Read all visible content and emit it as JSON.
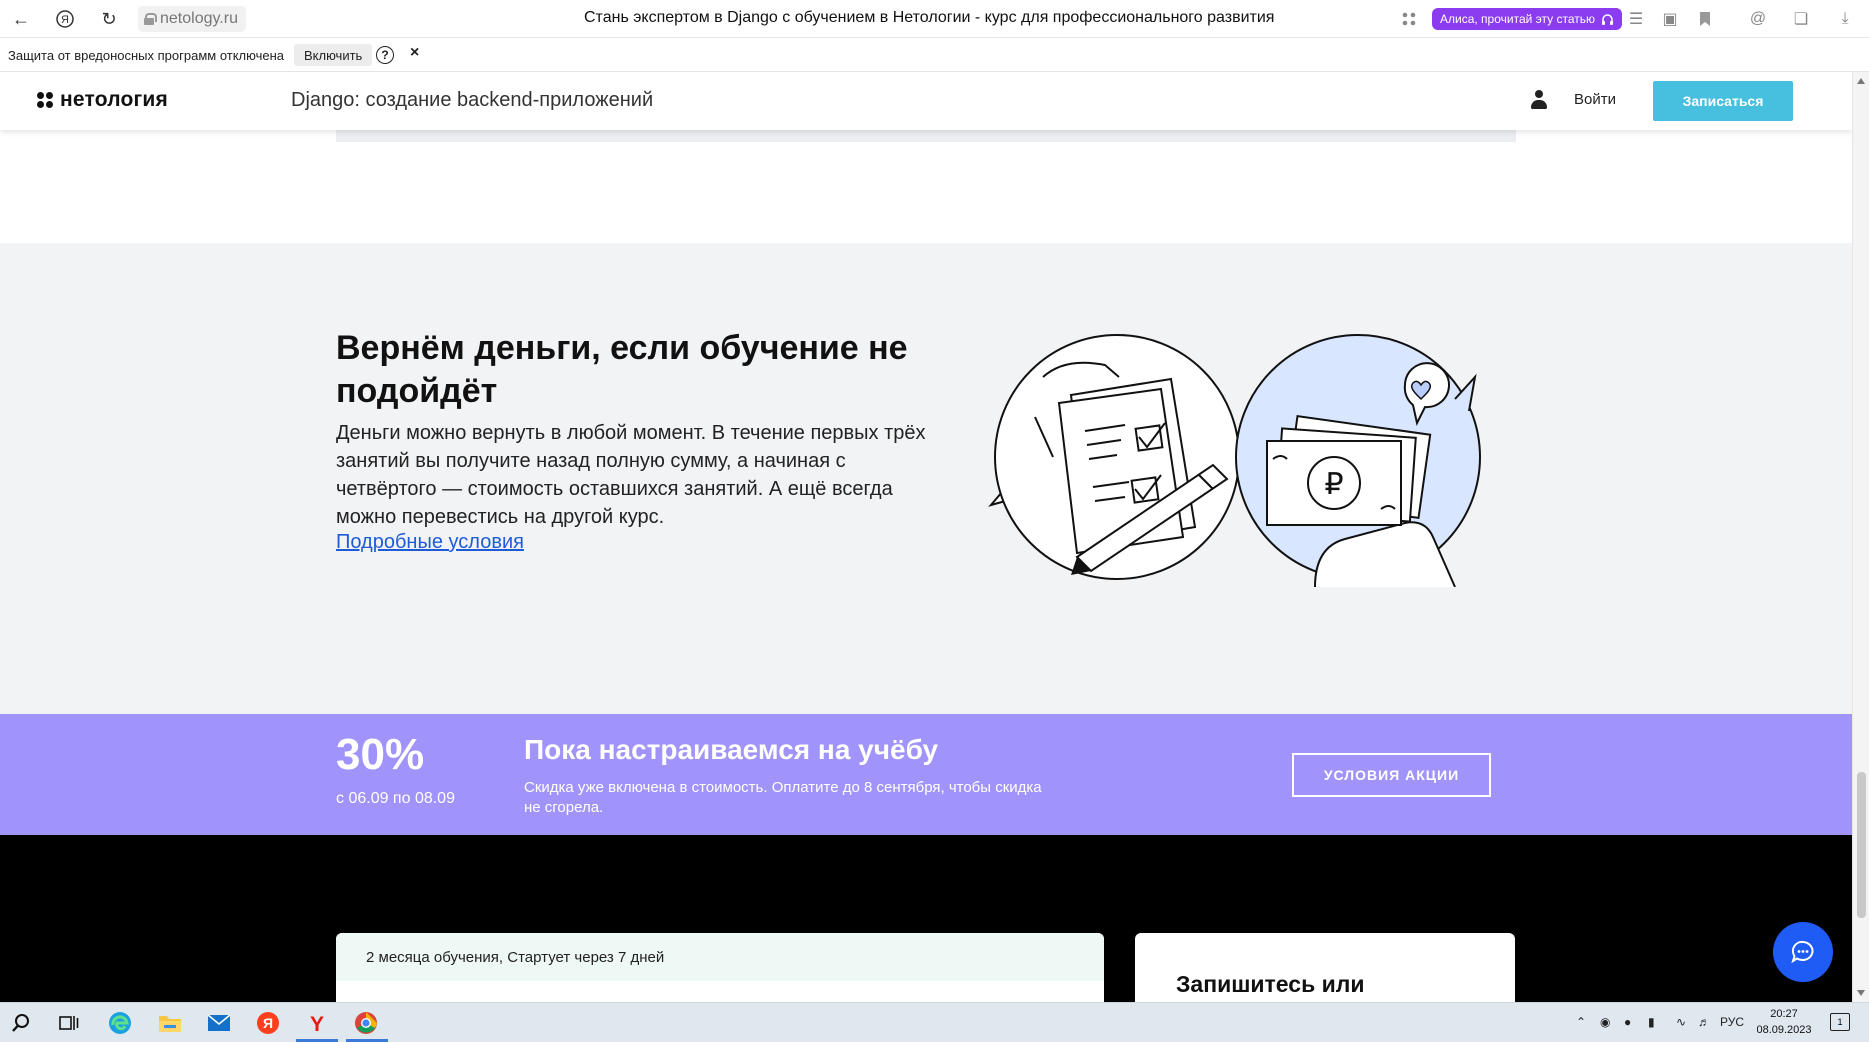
{
  "browser": {
    "url": "netology.ru",
    "tab_title": "Стань экспертом в Django с обучением в Нетологии - курс для профессионального развития",
    "alisa_label": "Алиса, прочитай эту статью"
  },
  "protection_bar": {
    "message": "Защита от вредоносных программ отключена",
    "enable_button": "Включить",
    "help_glyph": "?",
    "close_glyph": "×"
  },
  "header": {
    "logo_text": "нетология",
    "course_title": "Django: создание backend-приложений",
    "login_label": "Войти",
    "signup_label": "Записаться"
  },
  "refund": {
    "title": "Вернём деньги, если обучение не подойдёт",
    "text": "Деньги можно вернуть в любой момент. В течение первых трёх занятий вы получите назад полную сумму, а начиная с четвёртого — стоимость оставшихся занятий. А ещё всегда можно перевестись на другой курс.",
    "link": "Подробные условия"
  },
  "promo": {
    "percent": "30%",
    "dates": "с 06.09 по 08.09",
    "title": "Пока настраиваемся на учёбу",
    "subtitle": "Скидка уже включена в стоимость. Оплатите до 8 сентября, чтобы скидка не сгорела.",
    "button": "УСЛОВИЯ АКЦИИ"
  },
  "enroll": {
    "course_meta": "2 месяца обучения, Стартует через 7 дней",
    "cta_title": "Запишитесь или"
  },
  "taskbar": {
    "language": "РУС",
    "time": "20:27",
    "date": "08.09.2023",
    "notification_count": "1"
  },
  "colors": {
    "promo_bg": "#a094fb",
    "signup_bg": "#46c0de",
    "link": "#1f5bd8",
    "chat_fab": "#1f5cf5",
    "refund_bg": "#f2f3f5"
  }
}
